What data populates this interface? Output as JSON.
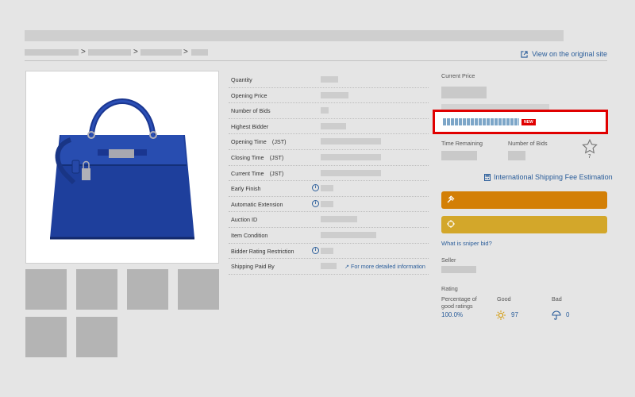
{
  "header": {
    "view_original": "View on the original site",
    "breadcrumb_separators": [
      ">",
      ">",
      ">"
    ]
  },
  "info": {
    "rows": [
      {
        "label": "Quantity"
      },
      {
        "label": "Opening Price"
      },
      {
        "label": "Number of Bids"
      },
      {
        "label": "Highest Bidder"
      },
      {
        "label": "Opening Time　(JST)"
      },
      {
        "label": "Closing Time　(JST)"
      },
      {
        "label": "Current Time　(JST)"
      },
      {
        "label": "Early Finish"
      },
      {
        "label": "Automatic Extension"
      },
      {
        "label": "Auction ID"
      },
      {
        "label": "Item Condition"
      },
      {
        "label": "Bidder Rating Restriction"
      },
      {
        "label": "Shipping Paid By"
      }
    ],
    "more_info": "For more detailed information"
  },
  "right": {
    "current_price_label": "Current Price",
    "new_badge": "NEW",
    "time_remaining_label": "Time Remaining",
    "number_of_bids_label": "Number of Bids",
    "watch_count": "7",
    "shipping_link": "International Shipping Fee Estimation",
    "sniper_link": "What is sniper bid?",
    "seller_label": "Seller",
    "rating_label": "Rating",
    "pct_label_line1": "Percentage of",
    "pct_label_line2": "good ratings",
    "pct_value": "100.0%",
    "good_label": "Good",
    "good_value": "97",
    "bad_label": "Bad",
    "bad_value": "0"
  },
  "colors": {
    "link": "#2a5d9a",
    "bid_button": "#d37f06",
    "sniper_button": "#d3a72a",
    "highlight": "#e00000",
    "bag": "#1e3f9c"
  },
  "icons": {
    "external": "external-link-icon",
    "info": "info-icon",
    "star": "star-icon",
    "calculator": "calculator-icon",
    "gavel": "gavel-icon",
    "sniper": "crosshair-icon",
    "sun": "sun-icon",
    "umbrella": "umbrella-icon"
  }
}
